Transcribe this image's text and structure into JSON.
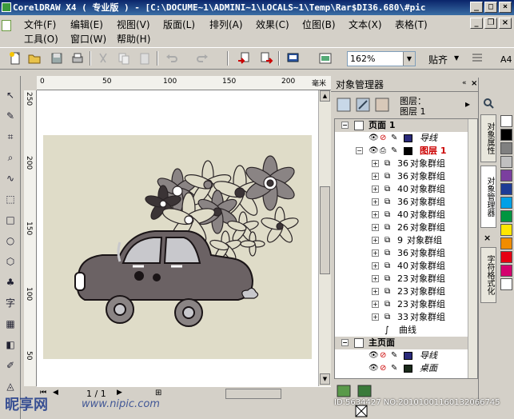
{
  "window": {
    "title": "CorelDRAW X4 ( 专业版 ) - [C:\\DOCUME~1\\ADMINI~1\\LOCALS~1\\Temp\\Rar$DI36.680\\#pic"
  },
  "menu": {
    "row1": [
      "文件(F)",
      "编辑(E)",
      "视图(V)",
      "版面(L)",
      "排列(A)",
      "效果(C)",
      "位图(B)",
      "文本(X)",
      "表格(T)"
    ],
    "row2": [
      "工具(O)",
      "窗口(W)",
      "帮助(H)"
    ]
  },
  "toolbar": {
    "zoom_value": "162%",
    "snap_label": "贴齐",
    "font_hint": "A4"
  },
  "rulers": {
    "horizontal": [
      "0",
      "50",
      "100",
      "150",
      "200",
      "毫米"
    ],
    "vertical": [
      "250",
      "200",
      "150",
      "100",
      "50"
    ]
  },
  "status": {
    "page_counter": "1 / 1"
  },
  "docker": {
    "title": "对象管理器",
    "layer_label_1": "图层：",
    "layer_label_2": "图层 1",
    "rows": [
      {
        "kind": "page",
        "text": "页面  1"
      },
      {
        "kind": "guide",
        "text": "导线"
      },
      {
        "kind": "layer",
        "text": "图层  1"
      },
      {
        "kind": "group",
        "num": "36",
        "text": "对象群组"
      },
      {
        "kind": "group",
        "num": "36",
        "text": "对象群组"
      },
      {
        "kind": "group",
        "num": "40",
        "text": "对象群组"
      },
      {
        "kind": "group",
        "num": "36",
        "text": "对象群组"
      },
      {
        "kind": "group",
        "num": "40",
        "text": "对象群组"
      },
      {
        "kind": "group",
        "num": "26",
        "text": "对象群组"
      },
      {
        "kind": "group",
        "num": "9",
        "text": "对象群组"
      },
      {
        "kind": "group",
        "num": "36",
        "text": "对象群组"
      },
      {
        "kind": "group",
        "num": "40",
        "text": "对象群组"
      },
      {
        "kind": "group",
        "num": "23",
        "text": "对象群组"
      },
      {
        "kind": "group",
        "num": "23",
        "text": "对象群组"
      },
      {
        "kind": "group",
        "num": "23",
        "text": "对象群组"
      },
      {
        "kind": "group",
        "num": "33",
        "text": "对象群组"
      },
      {
        "kind": "curve",
        "text": "曲线"
      },
      {
        "kind": "master",
        "text": "主页面"
      },
      {
        "kind": "guide",
        "text": "导线"
      },
      {
        "kind": "desktop",
        "text": "桌面"
      }
    ],
    "side_tabs": [
      "对象属性",
      "对象管理器",
      "字符格式化"
    ]
  },
  "watermark": {
    "brand": "昵享网",
    "url": "www.nipic.com",
    "id": "ID:5634427 NO:20101001160132066745"
  },
  "colors": {
    "page_bg": "#dfdcc8",
    "car_body": "#6b6264",
    "flower_dark": "#3b3436",
    "flower_mid": "#8a8484",
    "layer_red": "#cc0000",
    "palette": [
      "#ffffff",
      "#000000",
      "#808080",
      "#c0c0c0",
      "#7b3f9f",
      "#1e3c96",
      "#00a0e6",
      "#009640",
      "#ffe600",
      "#f08c00",
      "#e60012",
      "#d4006e",
      "#ffffff"
    ]
  }
}
